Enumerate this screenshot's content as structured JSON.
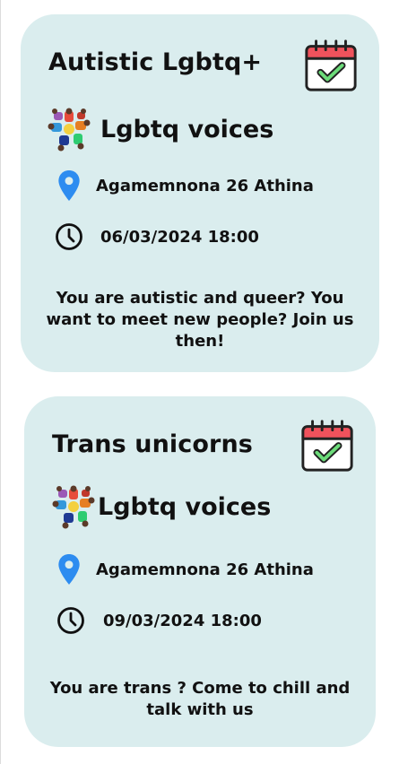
{
  "colors": {
    "card_bg": "#daedee",
    "pin": "#2d8cf0",
    "calendar_header": "#f0525c",
    "calendar_check": "#6cdc7a"
  },
  "icons": {
    "calendar": "calendar-check-icon",
    "location": "location-pin-icon",
    "time": "clock-icon",
    "organizer": "group-logo-icon"
  },
  "events": [
    {
      "title": "Autistic Lgbtq+",
      "organizer": "Lgbtq voices",
      "location": "Agamemnona 26 Athina",
      "datetime": "06/03/2024 18:00",
      "description": "You are autistic and queer? You want to meet new people? Join us then!"
    },
    {
      "title": "Trans unicorns",
      "organizer": "Lgbtq voices",
      "location": "Agamemnona 26 Athina",
      "datetime": "09/03/2024 18:00",
      "description": "You are trans ? Come to chill and talk with us"
    }
  ]
}
